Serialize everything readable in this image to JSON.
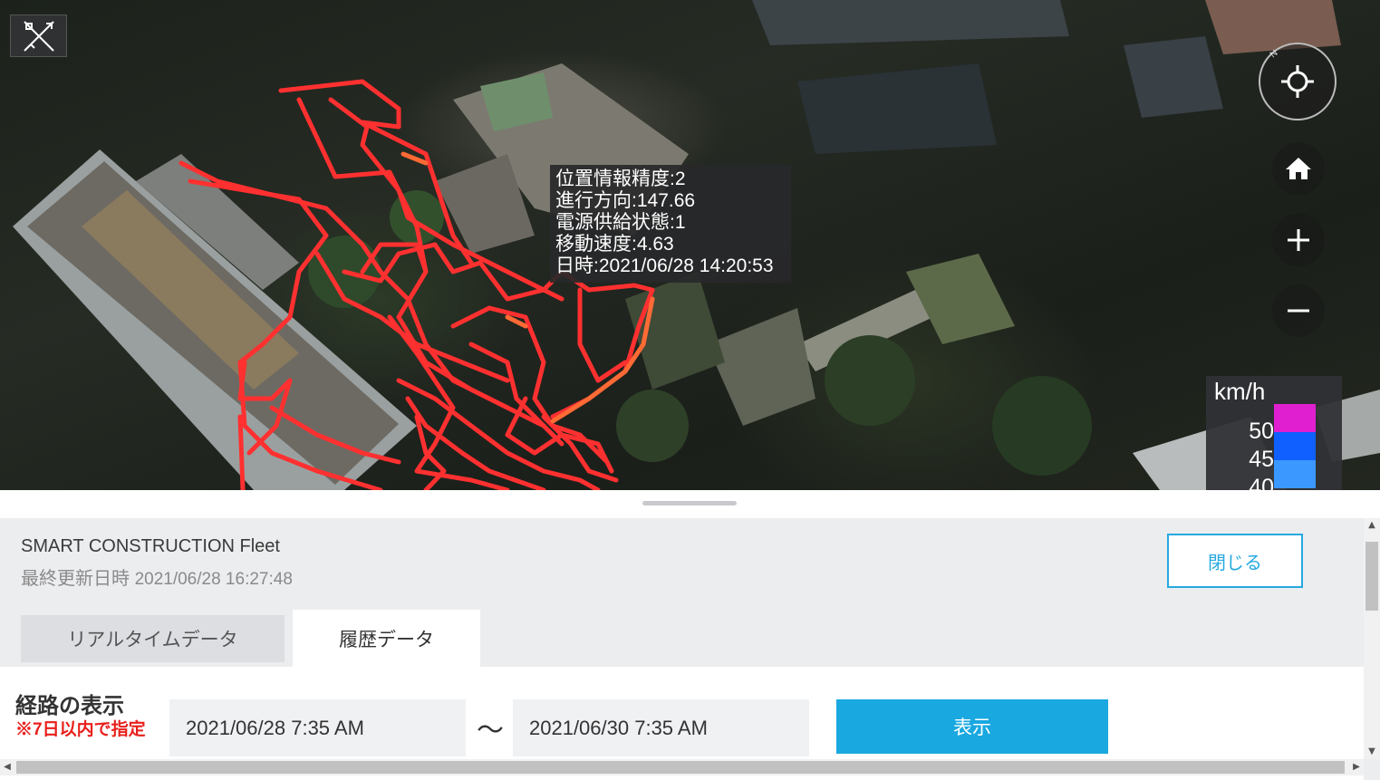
{
  "map": {
    "tooltip": {
      "accuracy": "位置情報精度:2",
      "heading": "進行方向:147.66",
      "power": "電源供給状態:1",
      "speed": "移動速度:4.63",
      "datetime": "日時:2021/06/28 14:20:53"
    },
    "legend": {
      "unit": "km/h",
      "items": [
        {
          "label": "50",
          "color": "#e020d0"
        },
        {
          "label": "45",
          "color": "#1060ff"
        },
        {
          "label": "40",
          "color": "#3a98ff"
        }
      ]
    },
    "route_color": "#ff3030",
    "controls": [
      "edit-icon",
      "compass-locate-icon",
      "home-icon",
      "zoom-in-icon",
      "zoom-out-icon"
    ]
  },
  "panel": {
    "app_title": "SMART CONSTRUCTION Fleet",
    "last_update_label": "最終更新日時",
    "last_update_value": "2021/06/28 16:27:48",
    "close_label": "閉じる",
    "tabs": [
      {
        "label": "リアルタイムデータ",
        "active": false
      },
      {
        "label": "履歴データ",
        "active": true
      }
    ],
    "route": {
      "title": "経路の表示",
      "note": "※7日以内で指定",
      "from": "2021/06/28 7:35 AM",
      "separator": "〜",
      "to": "2021/06/30 7:35 AM",
      "show_label": "表示"
    },
    "accent_color": "#19a8e0"
  }
}
